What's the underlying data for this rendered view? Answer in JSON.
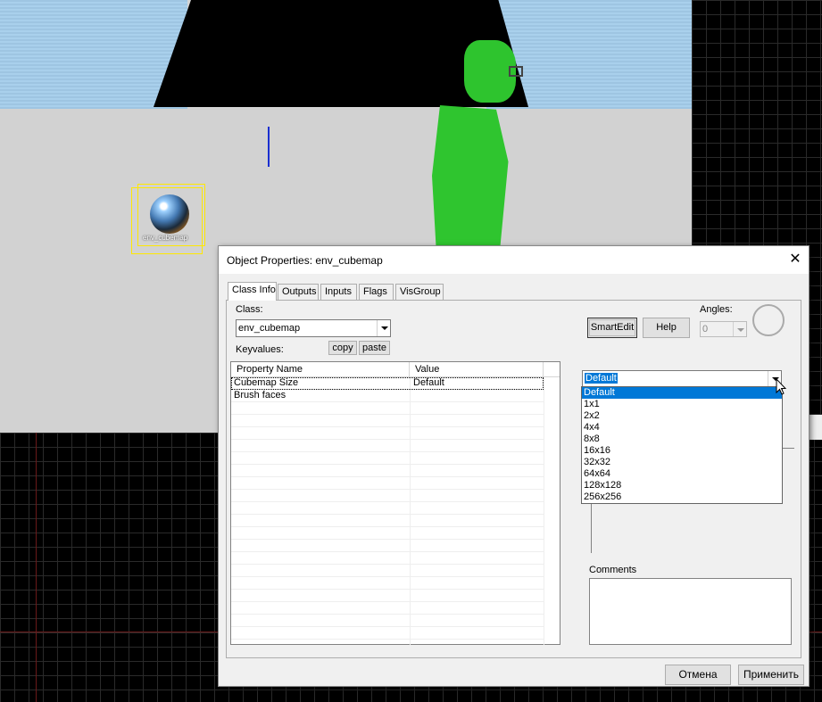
{
  "viewport": {
    "entity_label": "env_cubemap"
  },
  "dialog": {
    "title": "Object Properties: env_cubemap",
    "close_glyph": "✕",
    "tabs": [
      {
        "label": "Class Info",
        "active": true
      },
      {
        "label": "Outputs",
        "active": false
      },
      {
        "label": "Inputs",
        "active": false
      },
      {
        "label": "Flags",
        "active": false
      },
      {
        "label": "VisGroup",
        "active": false
      }
    ],
    "class_label": "Class:",
    "class_value": "env_cubemap",
    "keyvalues_label": "Keyvalues:",
    "copy_label": "copy",
    "paste_label": "paste",
    "smartedit_label": "SmartEdit",
    "help_label": "Help",
    "angles_label": "Angles:",
    "angles_value": "0",
    "grid": {
      "columns": [
        "Property Name",
        "Value"
      ],
      "rows": [
        {
          "name": "Cubemap Size",
          "value": "Default"
        },
        {
          "name": "Brush faces",
          "value": ""
        }
      ]
    },
    "value_combo": {
      "selected": "Default",
      "options": [
        "Default",
        "1x1",
        "2x2",
        "4x4",
        "8x8",
        "16x16",
        "32x32",
        "64x64",
        "128x128",
        "256x256"
      ]
    },
    "comments_label": "Comments",
    "cancel_label": "Отмена",
    "apply_label": "Применить"
  },
  "colors": {
    "selection": "#0078d7",
    "model_green": "#2fc52f",
    "selection_box": "#ffe800"
  }
}
